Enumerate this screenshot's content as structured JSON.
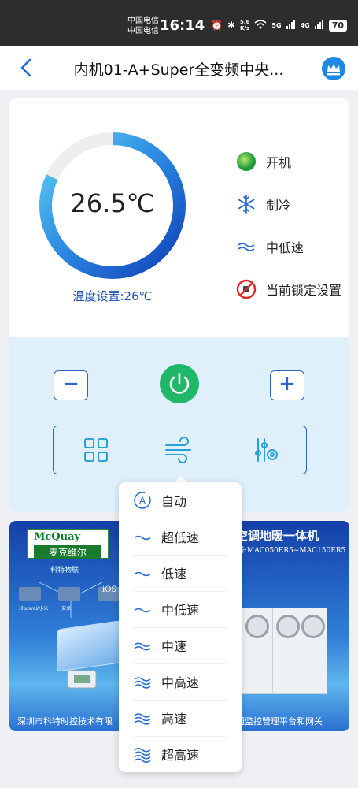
{
  "status_bar": {
    "carrier_1": "中国电信",
    "carrier_2": "中国电信",
    "time": "16:14",
    "net_speed_value": "5.6",
    "net_speed_unit": "K/s",
    "signal_1": "5G",
    "signal_2": "4G",
    "battery": "70"
  },
  "header": {
    "title": "内机01-A+Super全变频中央..."
  },
  "thermostat": {
    "current_temp": "26.5℃",
    "setting_label": "温度设置:26℃",
    "dial_fill_fraction": 0.82,
    "accent_color": "#1e6fd9"
  },
  "status_list": [
    {
      "icon": "power-status-icon",
      "label": "开机"
    },
    {
      "icon": "snowflake-icon",
      "label": "制冷"
    },
    {
      "icon": "fan-speed-icon",
      "label": "中低速"
    },
    {
      "icon": "lock-prohibited-icon",
      "label": "当前锁定设置"
    }
  ],
  "controls": {
    "minus_label": "−",
    "plus_label": "+"
  },
  "banner": {
    "brand": "McQuay",
    "brand_cn": "麦克维尔",
    "tech_label": "科特物联",
    "headline": "空调地暖一体机",
    "model": "号:MAC050ER5~MAC150ER5",
    "footer_left": "深圳市科特时控技术有限",
    "footer_right": "通监控管理平台和网关",
    "app_label_1": "Huawei/小米",
    "app_label_2": "安卓",
    "app_label_3": "iOS"
  },
  "fan_speed_menu": [
    {
      "label": "自动",
      "icon": "auto-mode-icon",
      "waves": 0
    },
    {
      "label": "超低速",
      "icon": "wave-1-icon",
      "waves": 1
    },
    {
      "label": "低速",
      "icon": "wave-1-icon",
      "waves": 1
    },
    {
      "label": "中低速",
      "icon": "wave-1-icon",
      "waves": 1
    },
    {
      "label": "中速",
      "icon": "wave-2-icon",
      "waves": 2
    },
    {
      "label": "中高速",
      "icon": "wave-3-icon",
      "waves": 3
    },
    {
      "label": "高速",
      "icon": "wave-3-icon",
      "waves": 3
    },
    {
      "label": "超高速",
      "icon": "wave-4-icon",
      "waves": 4
    }
  ]
}
